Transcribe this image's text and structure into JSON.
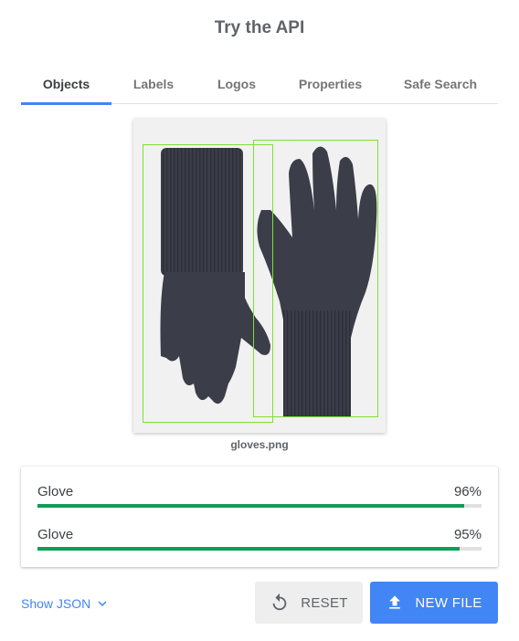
{
  "page": {
    "title": "Try the API"
  },
  "tabs": [
    {
      "label": "Objects",
      "active": true
    },
    {
      "label": "Labels",
      "active": false
    },
    {
      "label": "Logos",
      "active": false
    },
    {
      "label": "Properties",
      "active": false
    },
    {
      "label": "Safe Search",
      "active": false
    }
  ],
  "image": {
    "filename": "gloves.png",
    "subject": "pair of dark grey knit gloves"
  },
  "results": [
    {
      "name": "Glove",
      "score_label": "96%",
      "score": 0.96
    },
    {
      "name": "Glove",
      "score_label": "95%",
      "score": 0.95
    }
  ],
  "actions": {
    "show_json_label": "Show JSON",
    "reset_label": "RESET",
    "new_file_label": "NEW FILE"
  },
  "colors": {
    "accent": "#4285f4",
    "bar": "#0f9d58",
    "bbox": "#7fe030"
  },
  "icons": {
    "show_json": "chevron-down-icon",
    "reset": "refresh-icon",
    "new_file": "upload-icon"
  }
}
